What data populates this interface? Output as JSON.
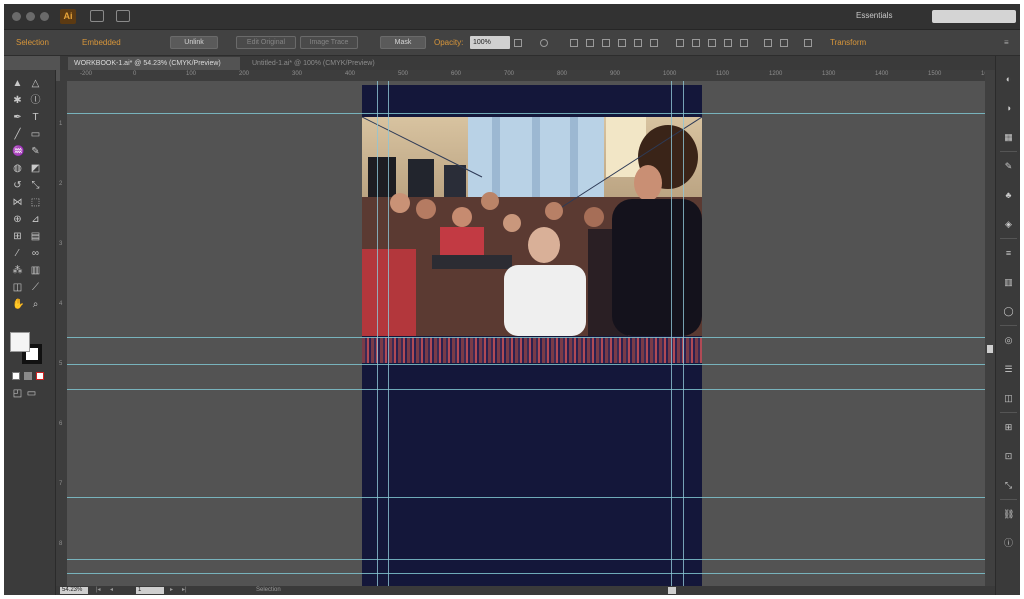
{
  "menubar": {
    "app_logo": "Ai",
    "workspace": "Essentials"
  },
  "controlbar": {
    "selection_label": "Selection",
    "embed_label": "Embedded",
    "buttons": [
      "Unlink",
      "Edit Original",
      "Image Trace",
      "Mask"
    ],
    "opacity_label": "Opacity:",
    "opacity_value": "100%",
    "transform_label": "Transform"
  },
  "document_tabs": [
    {
      "label": "WORKBOOK-1.ai* @ 54.23% (CMYK/Preview)"
    },
    {
      "label": "Untitled-1.ai* @ 100% (CMYK/Preview)"
    }
  ],
  "rulers": {
    "horizontal": [
      "-200",
      "0",
      "100",
      "200",
      "300",
      "400",
      "500",
      "600",
      "700",
      "800",
      "900",
      "1000",
      "1100",
      "1200",
      "1300",
      "1400",
      "1500",
      "1600"
    ],
    "vertical": [
      "1",
      "2",
      "3",
      "4",
      "5",
      "6",
      "7",
      "8"
    ]
  },
  "statusbar": {
    "zoom": "54.23%",
    "artboard": "1",
    "status": "Selection"
  },
  "tools": [
    {
      "icon": "selection-tool-icon",
      "glyph": "▲"
    },
    {
      "icon": "direct-selection-tool-icon",
      "glyph": "△"
    },
    {
      "icon": "magic-wand-tool-icon",
      "glyph": "✱"
    },
    {
      "icon": "lasso-tool-icon",
      "glyph": "ⓛ"
    },
    {
      "icon": "pen-tool-icon",
      "glyph": "✒"
    },
    {
      "icon": "type-tool-icon",
      "glyph": "T"
    },
    {
      "icon": "line-tool-icon",
      "glyph": "╱"
    },
    {
      "icon": "rectangle-tool-icon",
      "glyph": "▭"
    },
    {
      "icon": "paintbrush-tool-icon",
      "glyph": "♒"
    },
    {
      "icon": "pencil-tool-icon",
      "glyph": "✎"
    },
    {
      "icon": "blob-brush-tool-icon",
      "glyph": "◍"
    },
    {
      "icon": "eraser-tool-icon",
      "glyph": "◩"
    },
    {
      "icon": "rotate-tool-icon",
      "glyph": "↺"
    },
    {
      "icon": "scale-tool-icon",
      "glyph": "⤡"
    },
    {
      "icon": "width-tool-icon",
      "glyph": "⋈"
    },
    {
      "icon": "free-transform-tool-icon",
      "glyph": "⬚"
    },
    {
      "icon": "shape-builder-tool-icon",
      "glyph": "⊕"
    },
    {
      "icon": "perspective-grid-tool-icon",
      "glyph": "⊿"
    },
    {
      "icon": "mesh-tool-icon",
      "glyph": "⊞"
    },
    {
      "icon": "gradient-tool-icon",
      "glyph": "▤"
    },
    {
      "icon": "eyedropper-tool-icon",
      "glyph": "⁄"
    },
    {
      "icon": "blend-tool-icon",
      "glyph": "∞"
    },
    {
      "icon": "symbol-sprayer-tool-icon",
      "glyph": "⁂"
    },
    {
      "icon": "column-graph-tool-icon",
      "glyph": "▥"
    },
    {
      "icon": "artboard-tool-icon",
      "glyph": "◫"
    },
    {
      "icon": "slice-tool-icon",
      "glyph": "⟋"
    },
    {
      "icon": "hand-tool-icon",
      "glyph": "✋"
    },
    {
      "icon": "zoom-tool-icon",
      "glyph": "⌕"
    }
  ],
  "dock_icons": [
    "color-panel-icon",
    "color-guide-icon",
    "swatches-icon",
    "brushes-icon",
    "symbols-icon",
    "graphic-styles-icon",
    "stroke-icon",
    "gradient-icon",
    "transparency-icon",
    "appearance-icon",
    "layers-icon",
    "artboards-icon",
    "align-icon",
    "pathfinder-icon",
    "transform-icon",
    "links-icon",
    "info-icon"
  ],
  "colors": {
    "artboard_fill": "#14173a",
    "guide_color": "#7fc4cf",
    "canvas_bg": "#535353"
  }
}
